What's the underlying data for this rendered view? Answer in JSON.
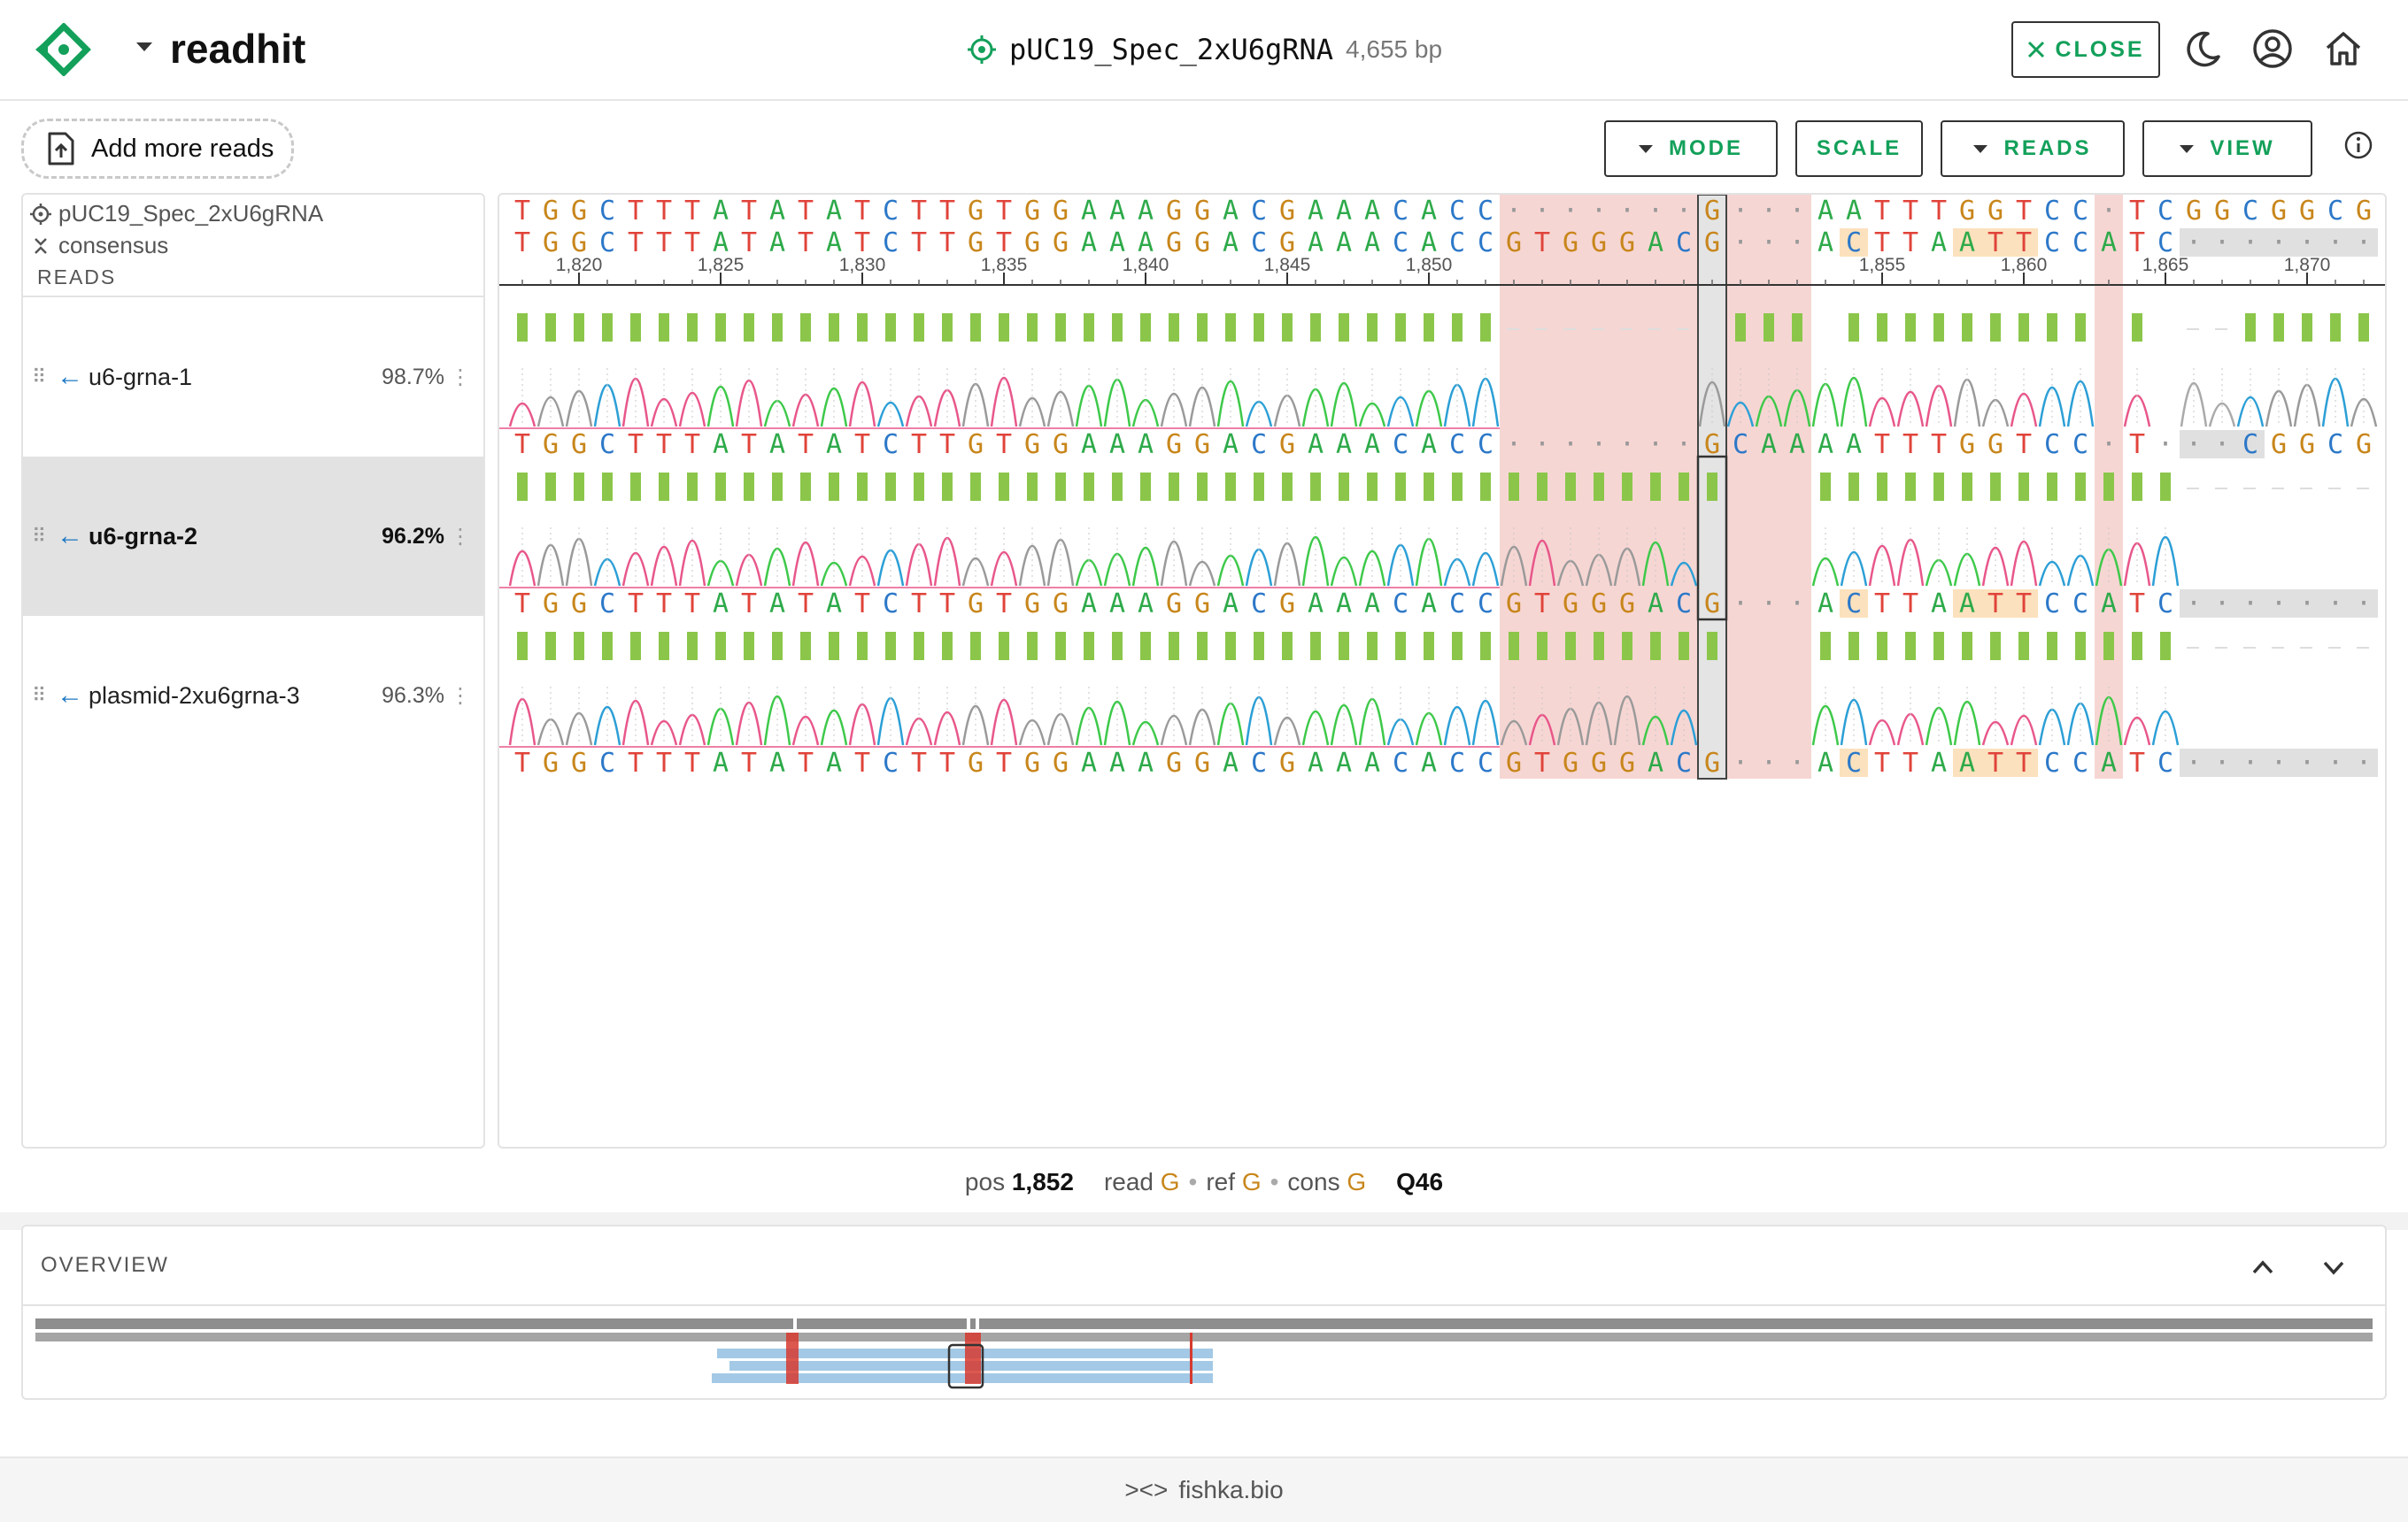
{
  "header": {
    "app_name": "readhit",
    "doc_title": "pUC19_Spec_2xU6gRNA",
    "doc_length": "4,655 bp",
    "close_label": "CLOSE"
  },
  "toolbar": {
    "add_reads_label": "Add more reads",
    "mode_label": "MODE",
    "scale_label": "SCALE",
    "reads_label": "READS",
    "view_label": "VIEW"
  },
  "sidebar": {
    "reference_name": "pUC19_Spec_2xU6gRNA",
    "consensus_label": "consensus",
    "reads_heading": "READS",
    "reads": [
      {
        "name": "u6-grna-1",
        "identity": "98.7%"
      },
      {
        "name": "u6-grna-2",
        "identity": "96.2%",
        "selected": true
      },
      {
        "name": "plasmid-2xu6grna-3",
        "identity": "96.3%"
      }
    ]
  },
  "alignment": {
    "reference_seq": "TGGCTTTATATATCTTGTGGAAAGGACGAAACACC·······G···AATTTGGTCC·TCGGCGGCGG",
    "consensus_seq": "TGGCTTTATATATCTTGTGGAAAGGACGAAACACCGTGGGACG···ACTTAATTCCATC········",
    "ruler_ticks": [
      "1,820",
      "1,825",
      "1,830",
      "1,835",
      "1,840",
      "1,845",
      "1,850",
      "1,855",
      "1,860",
      "1,865",
      "1,870"
    ],
    "read_sequences": [
      "TGGCTTTATATATCTTGTGGAAAGGACGAAACACC·······GCAAAATTTGGTCC·T···CGGCGG",
      "TGGCTTTATATATCTTGTGGAAAGGACGAAACACCGTGGGACG···ACTTAATTCCATC·······",
      "TGGCTTTATATATCTTGTGGAAAGGACGAAACACCGTGGGACG···ACTTAATTCCATC·······"
    ],
    "base_colors": {
      "A": "#2eaa4a",
      "C": "#2c78c8",
      "G": "#c8861b",
      "T": "#e0433a",
      "gap": "#999999"
    },
    "quality_color": "#8bc64a",
    "mismatch_bg": "#f6d6d3",
    "cursor_bg": "#e4e4e4",
    "highlight_bg": "#fbe1bd"
  },
  "status": {
    "pos_label": "pos",
    "pos_value": "1,852",
    "read_label": "read",
    "read_base": "G",
    "ref_label": "ref",
    "ref_base": "G",
    "cons_label": "cons",
    "cons_base": "G",
    "quality": "Q46"
  },
  "overview": {
    "title": "OVERVIEW"
  },
  "footer": {
    "text": "fishka.bio"
  }
}
